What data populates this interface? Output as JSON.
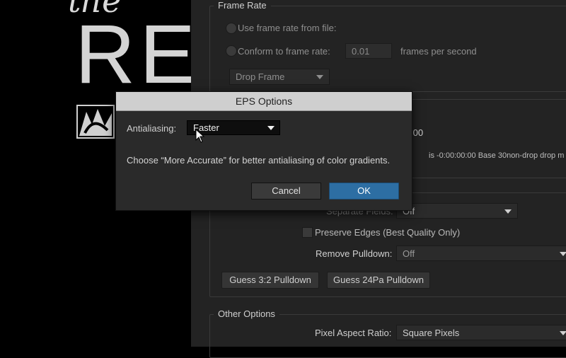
{
  "left_art": {
    "script_text": "the",
    "big_text": "RE"
  },
  "frame_rate": {
    "title": "Frame Rate",
    "use_from_file_label": "Use frame rate from file:",
    "conform_label": "Conform to frame rate:",
    "conform_value": "0.01",
    "conform_units": "frames per second",
    "drop_frame_value": "Drop Frame"
  },
  "partial": {
    "timecode_fragment": ":00",
    "base_info": "is -0:00:00:00  Base 30non-drop drop m"
  },
  "fields": {
    "separate_fields_label": "Separate Fields:",
    "separate_fields_value": "Off",
    "preserve_edges_label": "Preserve Edges (Best Quality Only)",
    "remove_pulldown_label": "Remove Pulldown:",
    "remove_pulldown_value": "Off",
    "guess_32_label": "Guess 3:2 Pulldown",
    "guess_24pa_label": "Guess 24Pa Pulldown"
  },
  "other_options": {
    "title": "Other Options",
    "pixel_aspect_label": "Pixel Aspect Ratio:",
    "pixel_aspect_value": "Square Pixels"
  },
  "dialog": {
    "title": "EPS Options",
    "antialiasing_label": "Antialiasing:",
    "antialiasing_value": "Faster",
    "hint": "Choose “More Accurate” for better antialiasing of color gradients.",
    "cancel_label": "Cancel",
    "ok_label": "OK",
    "ok_color": "#2d6ea3"
  },
  "icons": {
    "emblem": "logo-emblem-icon",
    "cursor": "mouse-pointer-icon"
  }
}
